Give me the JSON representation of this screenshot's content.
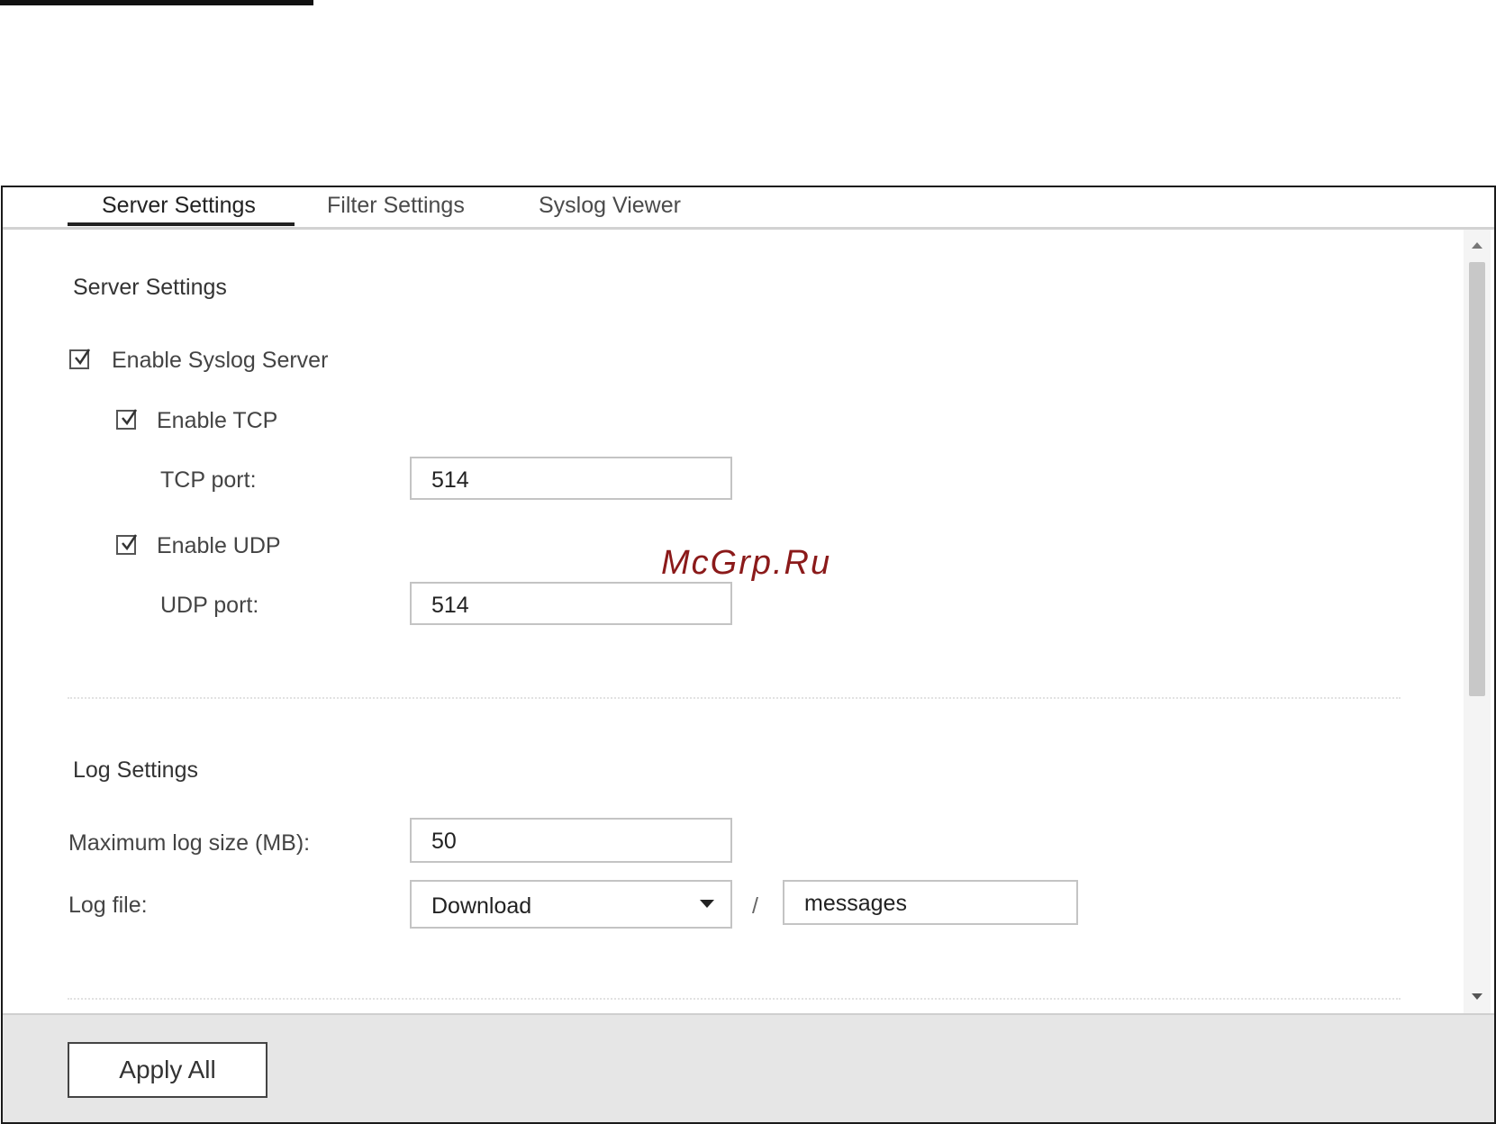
{
  "tabs": [
    {
      "label": "Server Settings",
      "active": true
    },
    {
      "label": "Filter Settings",
      "active": false
    },
    {
      "label": "Syslog Viewer",
      "active": false
    }
  ],
  "server_settings": {
    "title": "Server Settings",
    "enable_syslog_server": {
      "label": "Enable Syslog Server",
      "checked": true
    },
    "enable_tcp": {
      "label": "Enable TCP",
      "checked": true
    },
    "tcp_port": {
      "label": "TCP port:",
      "value": "514"
    },
    "enable_udp": {
      "label": "Enable UDP",
      "checked": true
    },
    "udp_port": {
      "label": "UDP port:",
      "value": "514"
    }
  },
  "log_settings": {
    "title": "Log Settings",
    "max_log_size": {
      "label": "Maximum log size (MB):",
      "value": "50"
    },
    "log_file": {
      "label": "Log file:",
      "folder": "Download",
      "separator": "/",
      "filename": "messages"
    }
  },
  "footer": {
    "apply_label": "Apply All"
  },
  "watermark": "McGrp.Ru"
}
